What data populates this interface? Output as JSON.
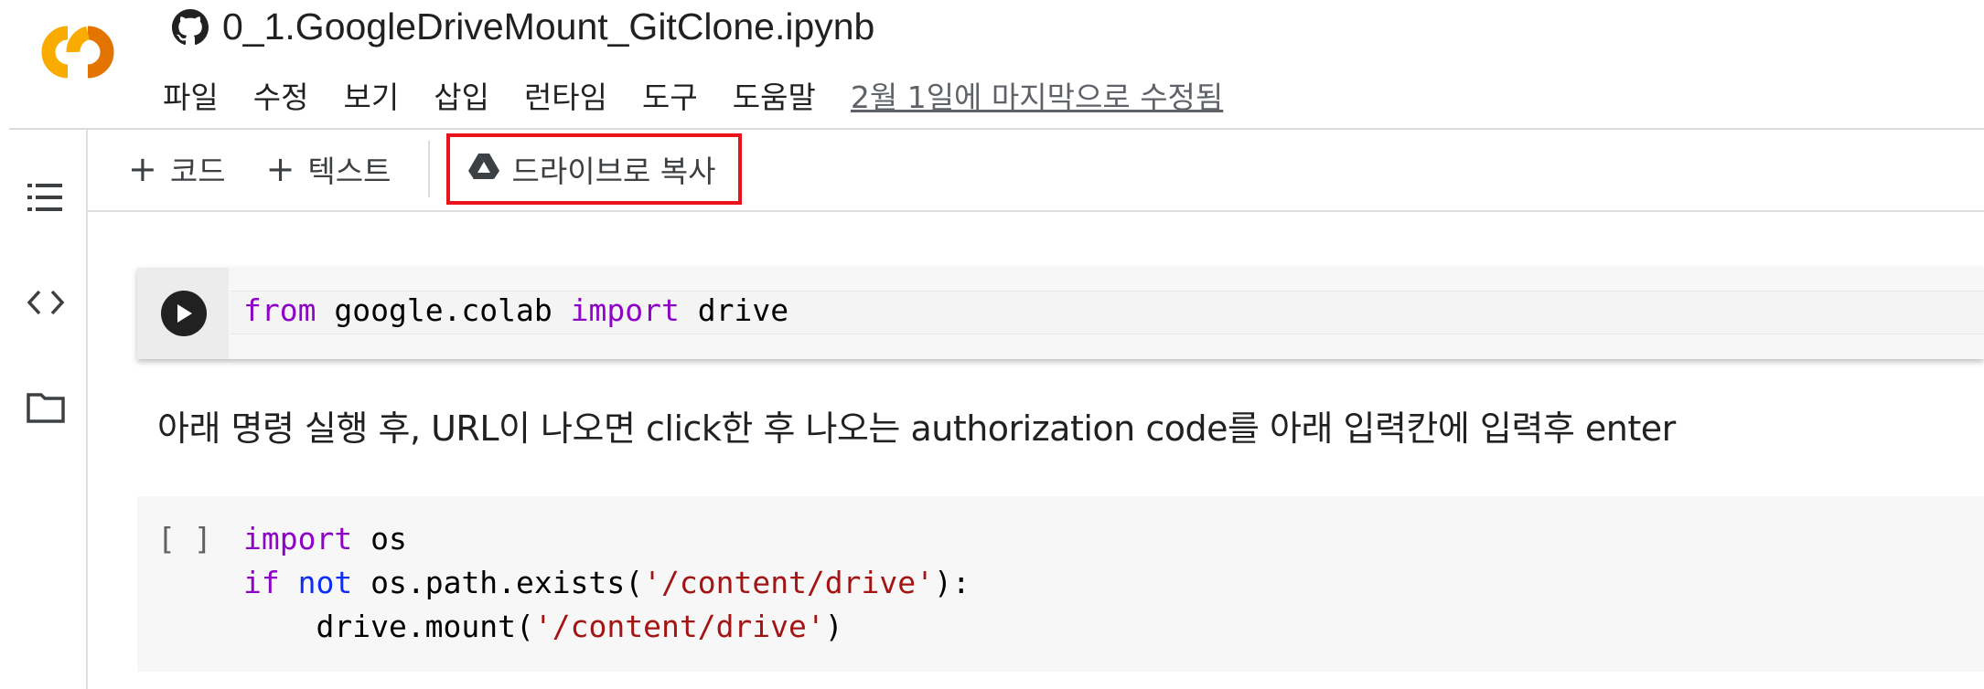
{
  "app": {
    "logo_text": "CO",
    "notebook_title": "0_1.GoogleDriveMount_GitClone.ipynb"
  },
  "menu": {
    "items": [
      "파일",
      "수정",
      "보기",
      "삽입",
      "런타임",
      "도구",
      "도움말"
    ],
    "last_edit": "2월 1일에 마지막으로 수정됨"
  },
  "toolbar": {
    "add_code": "코드",
    "add_text": "텍스트",
    "copy_to_drive": "드라이브로 복사"
  },
  "sidebar": {
    "icons": [
      "toc-icon",
      "code-snippets-icon",
      "folder-icon"
    ]
  },
  "cells": {
    "cell1": {
      "tokens": [
        "from",
        " google.colab ",
        "import",
        " drive"
      ]
    },
    "markdown": "아래 명령 실행 후, URL이 나오면 click한 후 나오는 authorization code를 아래 입력칸에 입력후 enter",
    "cell2": {
      "exec_count": "[ ]",
      "line1": [
        "import",
        " os"
      ],
      "line2": [
        "if",
        " ",
        "not",
        " os.path.exists(",
        "'/content/drive'",
        "):"
      ],
      "line3": [
        "    drive.mount(",
        "'/content/drive'",
        ")"
      ]
    }
  },
  "colors": {
    "logo_orange": "#f9ab00",
    "logo_amber": "#e37400",
    "highlight_red": "#e8131b",
    "keyword_purple": "#8e04c7",
    "keyword_blue": "#0e2ef5",
    "string_red": "#a31515"
  }
}
